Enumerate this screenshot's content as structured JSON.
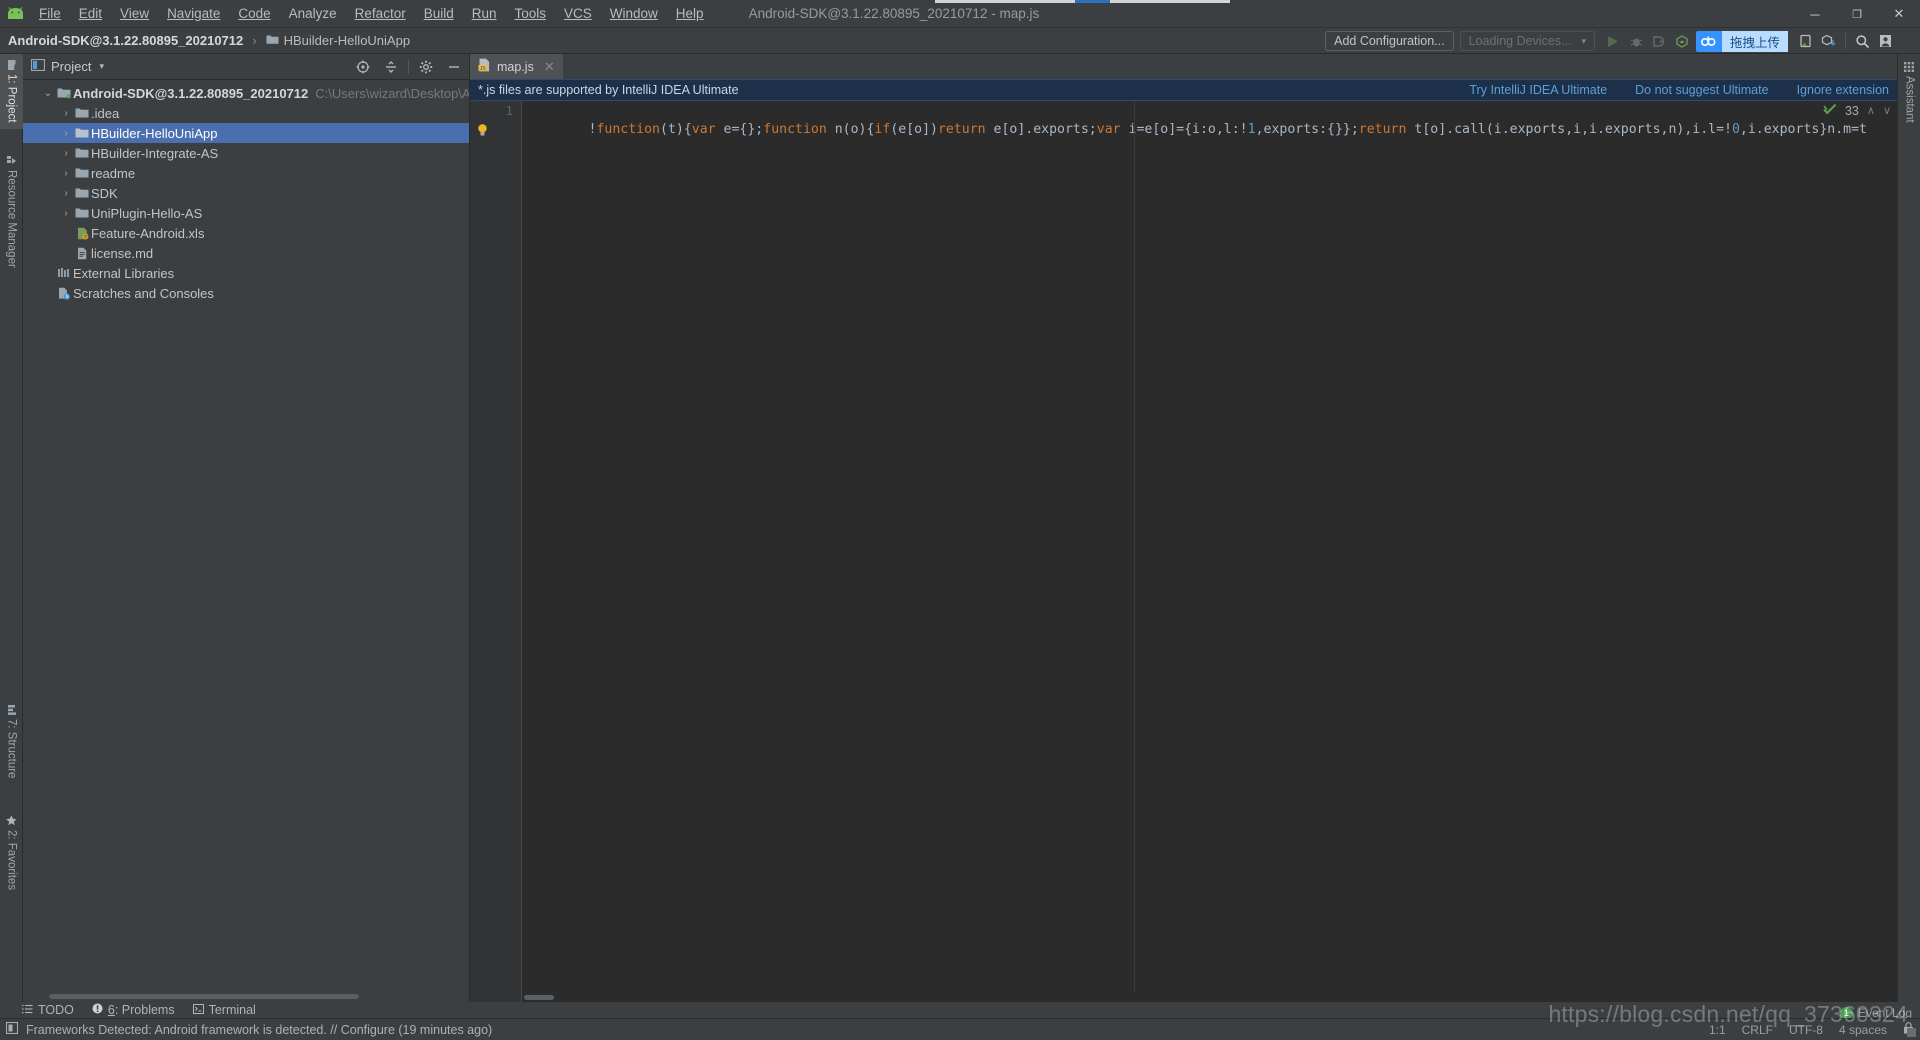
{
  "window": {
    "title": "Android-SDK@3.1.22.80895_20210712 - map.js",
    "minimize": "─",
    "maximize": "❐",
    "close": "✕"
  },
  "menu": [
    {
      "label": "File"
    },
    {
      "label": "Edit"
    },
    {
      "label": "View"
    },
    {
      "label": "Navigate"
    },
    {
      "label": "Code"
    },
    {
      "label": "Analyze"
    },
    {
      "label": "Refactor"
    },
    {
      "label": "Build"
    },
    {
      "label": "Run"
    },
    {
      "label": "Tools"
    },
    {
      "label": "VCS"
    },
    {
      "label": "Window"
    },
    {
      "label": "Help"
    }
  ],
  "breadcrumb": {
    "project": "Android-SDK@3.1.22.80895_20210712",
    "separator": "›",
    "module": "HBuilder-HelloUniApp"
  },
  "toolbar": {
    "add_configuration": "Add Configuration...",
    "loading_devices": "Loading Devices...",
    "device_caret": "▾",
    "upload_label": "拖拽上传",
    "icons": [
      {
        "name": "run-icon",
        "glyph": "▶"
      },
      {
        "name": "debug-icon",
        "glyph": "ὁE"
      },
      {
        "name": "attach-debugger-icon",
        "glyph": "◐"
      },
      {
        "name": "profiler-icon",
        "glyph": "⬡"
      },
      {
        "name": "upload-cloud-icon",
        "glyph": "☁"
      },
      {
        "name": "avd-manager-icon",
        "glyph": "▣"
      },
      {
        "name": "sdk-manager-icon",
        "glyph": "⬇"
      },
      {
        "name": "search-everywhere-icon",
        "glyph": "⌕"
      },
      {
        "name": "user-account-icon",
        "glyph": "▣"
      }
    ]
  },
  "left_tool_strip": [
    {
      "label": "1: Project",
      "active": true
    },
    {
      "label": "Resource Manager",
      "active": false
    },
    {
      "label": "7: Structure",
      "active": false
    },
    {
      "label": "2: Favorites",
      "active": false
    }
  ],
  "right_tool_strip": [
    {
      "label": "Assistant"
    }
  ],
  "project_panel": {
    "title": "Project",
    "dropdown_caret": "▾",
    "header_icons": [
      {
        "name": "select-opened-file-icon",
        "glyph": "⊕"
      },
      {
        "name": "collapse-all-icon",
        "glyph": "↕"
      },
      {
        "name": "settings-gear-icon",
        "glyph": "⚙"
      },
      {
        "name": "hide-panel-icon",
        "glyph": "─"
      }
    ],
    "tree": [
      {
        "label": "Android-SDK@3.1.22.80895_20210712",
        "path": "C:\\Users\\wizard\\Desktop\\And",
        "indent": 0,
        "arrow": "⌄",
        "icon": "module-icon",
        "root": true,
        "selected": false
      },
      {
        "label": ".idea",
        "path": "",
        "indent": 1,
        "arrow": "›",
        "icon": "folder-icon",
        "root": false,
        "selected": false
      },
      {
        "label": "HBuilder-HelloUniApp",
        "path": "",
        "indent": 1,
        "arrow": "›",
        "icon": "folder-icon",
        "root": false,
        "selected": true
      },
      {
        "label": "HBuilder-Integrate-AS",
        "path": "",
        "indent": 1,
        "arrow": "›",
        "icon": "folder-icon",
        "root": false,
        "selected": false
      },
      {
        "label": "readme",
        "path": "",
        "indent": 1,
        "arrow": "›",
        "icon": "folder-icon",
        "root": false,
        "selected": false
      },
      {
        "label": "SDK",
        "path": "",
        "indent": 1,
        "arrow": "›",
        "icon": "folder-icon",
        "root": false,
        "selected": false
      },
      {
        "label": "UniPlugin-Hello-AS",
        "path": "",
        "indent": 1,
        "arrow": "›",
        "icon": "folder-icon",
        "root": false,
        "selected": false
      },
      {
        "label": "Feature-Android.xls",
        "path": "",
        "indent": 1,
        "arrow": "",
        "icon": "xls-file-icon",
        "root": false,
        "selected": false
      },
      {
        "label": "license.md",
        "path": "",
        "indent": 1,
        "arrow": "",
        "icon": "markdown-file-icon",
        "root": false,
        "selected": false
      },
      {
        "label": "External Libraries",
        "path": "",
        "indent": 0,
        "arrow": "",
        "icon": "libraries-icon",
        "root": false,
        "selected": false
      },
      {
        "label": "Scratches and Consoles",
        "path": "",
        "indent": 0,
        "arrow": "",
        "icon": "scratches-icon",
        "root": false,
        "selected": false
      }
    ]
  },
  "editor": {
    "tab": {
      "label": "map.js",
      "icon": "js-file-icon",
      "close": "✕"
    },
    "notification": {
      "message": "*.js files are supported by IntelliJ IDEA Ultimate",
      "links": [
        {
          "label": "Try IntelliJ IDEA Ultimate"
        },
        {
          "label": "Do not suggest Ultimate"
        },
        {
          "label": "Ignore extension"
        }
      ]
    },
    "line_number": "1",
    "code_tokens": [
      {
        "t": "!",
        "c": "p"
      },
      {
        "t": "function",
        "c": "k"
      },
      {
        "t": "(t){",
        "c": "p"
      },
      {
        "t": "var",
        "c": "k"
      },
      {
        "t": " e={};",
        "c": "p"
      },
      {
        "t": "function",
        "c": "k"
      },
      {
        "t": " n(o){",
        "c": "p"
      },
      {
        "t": "if",
        "c": "k"
      },
      {
        "t": "(e[o])",
        "c": "p"
      },
      {
        "t": "return",
        "c": "k"
      },
      {
        "t": " e[o].exports;",
        "c": "p"
      },
      {
        "t": "var",
        "c": "k"
      },
      {
        "t": " i=e[o]={i:o,l:!",
        "c": "p"
      },
      {
        "t": "1",
        "c": "n"
      },
      {
        "t": ",exports:{}};",
        "c": "p"
      },
      {
        "t": "return",
        "c": "k"
      },
      {
        "t": " t[o].call(i.exports,i,i.exports,n),i.l=!",
        "c": "p"
      },
      {
        "t": "0",
        "c": "n"
      },
      {
        "t": ",i.exports}n.m=t",
        "c": "p"
      }
    ],
    "inspection": {
      "status_icon": "inspection-ok-icon",
      "problem_count": "33",
      "up": "∧",
      "down": "∨"
    },
    "intention_bulb": "intention-bulb-icon"
  },
  "bottom_tool_strip": [
    {
      "label": "TODO",
      "icon": "todo-icon",
      "mnemonic": ""
    },
    {
      "label": "Problems",
      "icon": "problems-icon",
      "mnemonic": "6"
    },
    {
      "label": "Terminal",
      "icon": "terminal-icon",
      "mnemonic": ""
    }
  ],
  "status_bar": {
    "icon": "inspector-icon",
    "message": "Frameworks Detected: Android framework is detected. // Configure (19 minutes ago)",
    "caret_position": "1:1",
    "line_separator": "CRLF",
    "encoding": "UTF-8",
    "indent": "4 spaces",
    "lock_icon": "read-write-lock-icon"
  },
  "event_log": {
    "label": "Event Log",
    "count": "1"
  },
  "watermark": "https://blog.csdn.net/qq_37360324",
  "colors": {
    "accent_blue": "#4b6eaf",
    "selection_blue": "#3592ff",
    "notification_bg": "#1d3049",
    "editor_bg": "#2b2b2b",
    "panel_bg": "#3c3f41",
    "keyword_orange": "#cc7832",
    "number_blue": "#6897bb",
    "link_blue": "#5c9fd8",
    "green_badge": "#499c54"
  }
}
